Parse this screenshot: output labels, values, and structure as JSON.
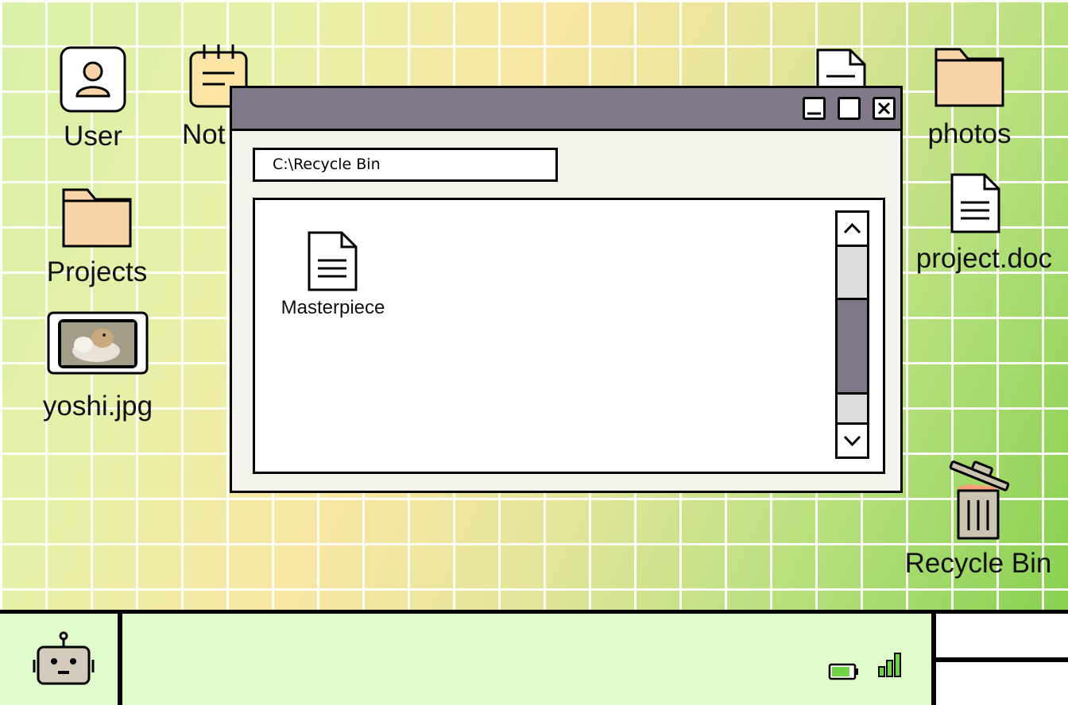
{
  "desktop": {
    "icons": [
      {
        "id": "user",
        "label": "User"
      },
      {
        "id": "notes",
        "label": "Not"
      },
      {
        "id": "projects",
        "label": "Projects"
      },
      {
        "id": "yoshi",
        "label": "yoshi.jpg"
      },
      {
        "id": "photos",
        "label": "photos"
      },
      {
        "id": "project_doc",
        "label": "project.doc"
      },
      {
        "id": "recycle_bin",
        "label": "Recycle Bin"
      }
    ]
  },
  "window": {
    "path": "C:\\Recycle Bin",
    "files": [
      {
        "label": "Masterpiece"
      }
    ],
    "scroll_position": 0.4
  },
  "colors": {
    "titlebar": "#807888",
    "folder": "#f8d4a8",
    "note": "#fbe5a6",
    "taskbar": "#e0fcca",
    "battery": "#6fd443"
  },
  "taskbar": {
    "start_icon": "robot-icon",
    "battery_icon": "battery-icon",
    "signal_icon": "signal-icon"
  }
}
